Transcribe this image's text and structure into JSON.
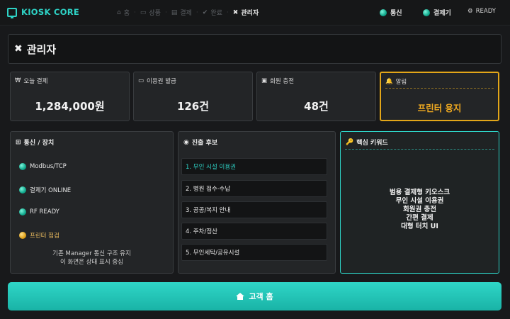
{
  "topbar": {
    "brand": "KIOSK CORE",
    "crumbs": [
      {
        "icon": "home-icon",
        "glyph": "⌂",
        "label": "홈"
      },
      {
        "icon": "ticket-icon",
        "glyph": "▭",
        "label": "상품"
      },
      {
        "icon": "card-icon",
        "glyph": "▤",
        "label": "결제"
      },
      {
        "icon": "check-icon",
        "glyph": "✔",
        "label": "완료"
      },
      {
        "icon": "tools-icon",
        "glyph": "✖",
        "label": "관리자"
      }
    ],
    "status": [
      {
        "label": "통신"
      },
      {
        "label": "결제기"
      }
    ],
    "ready": "READY"
  },
  "title": {
    "icon": "tools-icon",
    "label": "관리자"
  },
  "cards": [
    {
      "icon": "won-icon",
      "glyph": "₩",
      "label": "오늘 결제",
      "value": "1,284,000원"
    },
    {
      "icon": "ticket-icon",
      "glyph": "▭",
      "label": "이용권 발급",
      "value": "126건"
    },
    {
      "icon": "id-card-icon",
      "glyph": "▣",
      "label": "회원 충전",
      "value": "48건"
    },
    {
      "icon": "bell-icon",
      "glyph": "🔔",
      "label": "알림",
      "value": "프린터 용지"
    }
  ],
  "devices": {
    "title": "통신 / 장치",
    "items": [
      {
        "label": "Modbus/TCP",
        "state": "ok"
      },
      {
        "label": "결제기 ONLINE",
        "state": "ok"
      },
      {
        "label": "RF READY",
        "state": "ok"
      },
      {
        "label": "프린터 점검",
        "state": "warn"
      }
    ],
    "note_line1": "기존 Manager 통신 구조 유지",
    "note_line2": "이 화면은 상태 표시 중심"
  },
  "candidates": {
    "title": "진출 후보",
    "items": [
      "1. 무인 시설 이용권",
      "2. 병원 접수·수납",
      "3. 공공/복지 안내",
      "4. 주차/정산",
      "5. 무인세탁/공유시설"
    ]
  },
  "keywords": {
    "title": "핵심 키워드",
    "items": [
      "범용 결제형 키오스크",
      "무인 시설 이용권",
      "회원권 충전",
      "간편 결제",
      "대형 터치 UI"
    ]
  },
  "home_button": {
    "icon": "home-icon",
    "label": "고객 홈"
  },
  "colors": {
    "accent": "#2ed3c6",
    "warn": "#e2a619",
    "ok": "#10a98d"
  }
}
